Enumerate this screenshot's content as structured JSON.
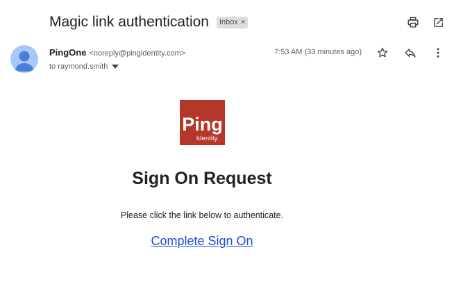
{
  "email": {
    "subject": "Magic link authentication",
    "label_chip": "Inbox",
    "label_remove": "×",
    "sender_name": "PingOne",
    "sender_email": "<noreply@pingidentity.com>",
    "recipient": "to raymond.smith",
    "timestamp": "7:53 AM (33 minutes ago)"
  },
  "icons": {
    "print": "print-icon",
    "open_new_window": "open-in-new-window-icon",
    "star": "star-icon",
    "reply": "reply-icon",
    "more": "more-vert-icon",
    "recipient_caret": "caret-down-icon",
    "avatar": "default-avatar-icon"
  },
  "body": {
    "logo_word": "Ping",
    "logo_subword": "Identity.",
    "heading": "Sign On Request",
    "instruction": "Please click the link below to authenticate.",
    "link_text": "Complete Sign On"
  },
  "colors": {
    "logo_bg": "#b5372a",
    "link": "#1a4fd6",
    "avatar_bg": "#a8c7fa",
    "avatar_fg": "#4a7fd9"
  }
}
